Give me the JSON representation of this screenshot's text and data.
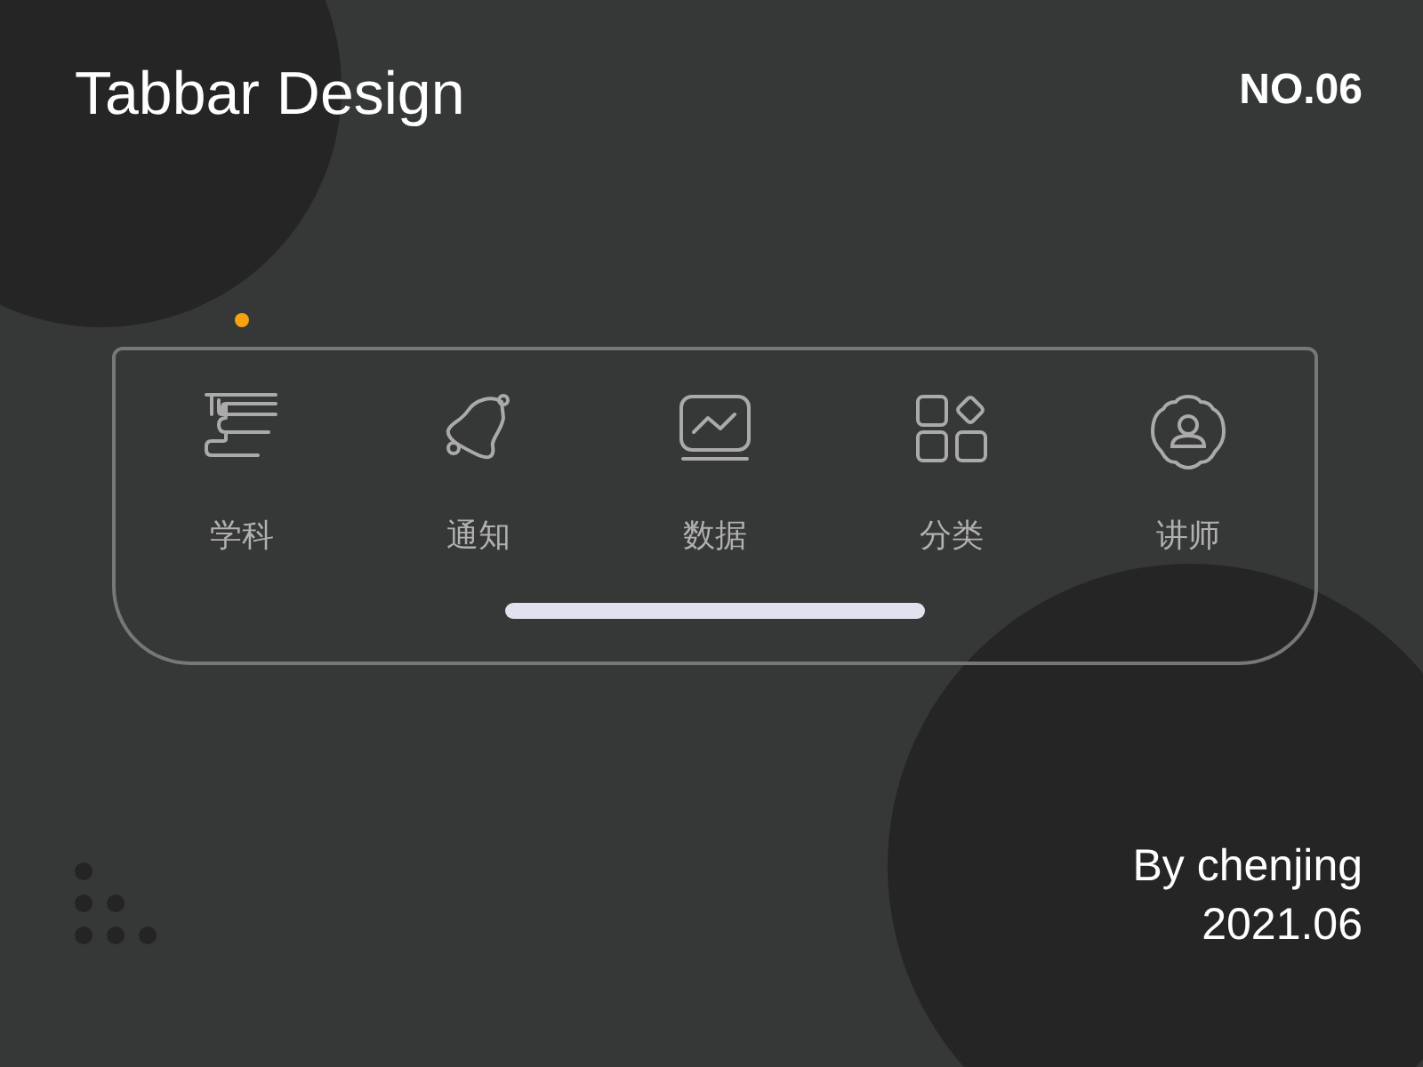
{
  "title": "Tabbar Design",
  "number": "NO.06",
  "tabs": [
    {
      "label": "学科",
      "kind": "books",
      "selected": true
    },
    {
      "label": "通知",
      "kind": "bell",
      "selected": false
    },
    {
      "label": "数据",
      "kind": "monitor",
      "selected": false
    },
    {
      "label": "分类",
      "kind": "grid",
      "selected": false
    },
    {
      "label": "讲师",
      "kind": "user",
      "selected": false
    }
  ],
  "author": "By chenjing",
  "date": "2021.06"
}
